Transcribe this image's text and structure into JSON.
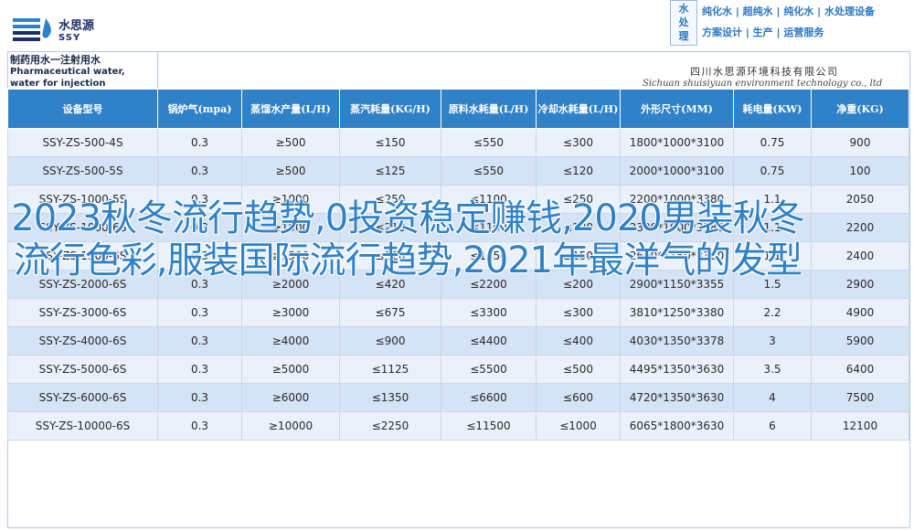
{
  "header": {
    "logo_cn": "水思源",
    "logo_en": "SSY",
    "brand_vertical": "水处理",
    "tagline_line1": "纯化水 | 超纯水 | 纯化水 | 水处理设备",
    "tagline_line2": "方案设计 | 生产 | 运营服务"
  },
  "document": {
    "title_zh": "制药用水一注射用水",
    "title_en": "Pharmaceutical water, water for injection",
    "company_cn": "四川水思源环境科技有限公司",
    "company_en": "Sichuan shuisiyuan environment technology co., ltd"
  },
  "table": {
    "headers": [
      "设备型号",
      "锅炉气(mpa)",
      "蒸馏水产量(L/H)",
      "蒸汽耗量(KG/H)",
      "原料水耗量(L/H)",
      "冷却水耗量(L/H)",
      "外形尺寸(MM)",
      "耗电量(KW)",
      "净重(KG)"
    ],
    "rows": [
      [
        "SSY-ZS-500-4S",
        "0.3",
        "≥500",
        "≤150",
        "≤550",
        "≤300",
        "1800*1000*3100",
        "0.75",
        "900"
      ],
      [
        "SSY-ZS-500-5S",
        "0.3",
        "≥500",
        "≤125",
        "≤550",
        "≤120",
        "2000*1000*3100",
        "0.75",
        "100"
      ],
      [
        "SSY-ZS-1000-5S",
        "0.3",
        "≥1000",
        "≤250",
        "≤1100",
        "≤250",
        "2200*1000*3380",
        "1.1",
        "2050"
      ],
      [
        "SSY-ZS-1000-6S",
        "0.3",
        "≥1000",
        "≤210",
        "≤1100",
        "≤100",
        "2300*1000*3380",
        "1.1",
        "2200"
      ],
      [
        "SSY-ZS-1500-6S",
        "0.3",
        "≥1500",
        "≤320",
        "≤1650",
        "≤150",
        "2600*1150*3380",
        "1.1",
        "2400"
      ],
      [
        "SSY-ZS-2000-6S",
        "0.3",
        "≥2000",
        "≤420",
        "≤2200",
        "≤200",
        "2900*1150*3355",
        "1.5",
        "2900"
      ],
      [
        "SSY-ZS-3000-6S",
        "0.3",
        "≥3000",
        "≤675",
        "≤3300",
        "≤300",
        "3810*1250*3380",
        "2.2",
        "4900"
      ],
      [
        "SSY-ZS-4000-6S",
        "0.3",
        "≥4000",
        "≤900",
        "≤4400",
        "≤400",
        "4030*1350*3378",
        "3",
        "5900"
      ],
      [
        "SSY-ZS-5000-6S",
        "0.3",
        "≥5000",
        "≤1125",
        "≤5500",
        "≤500",
        "4495*1350*3630",
        "3.5",
        "6400"
      ],
      [
        "SSY-ZS-6000-6S",
        "0.3",
        "≥6000",
        "≤1350",
        "≤6600",
        "≤600",
        "4720*1350*3630",
        "4",
        "7500"
      ],
      [
        "SSY-ZS-10000-6S",
        "0.3",
        "≥10000",
        "≤2250",
        "≤11500",
        "≤1000",
        "6065*1800*3630",
        "6",
        "12100"
      ]
    ]
  },
  "overlay_text": "2023秋冬流行趋势,0投资稳定赚钱,2020男装秋冬流行色彩,服装国际流行趋势,2021年最洋气的发型",
  "colors": {
    "header_blue": "#2f81c8",
    "row_light": "#eaf1fb",
    "row_dark": "#d4e3f5",
    "logo_navy": "#1a2f6b"
  }
}
